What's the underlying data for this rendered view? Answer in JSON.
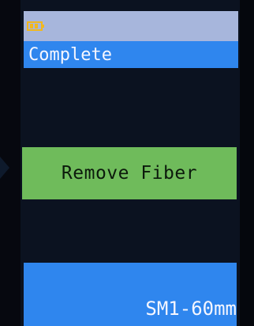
{
  "header": {
    "icon": "battery-icon"
  },
  "status": {
    "label": "Complete"
  },
  "message": {
    "label": "Remove Fiber"
  },
  "program": {
    "label": "SM1-60mm"
  },
  "colors": {
    "status_bar": "#2f86ee",
    "message_box": "#6fbb5b",
    "header_strip": "#a7b6dc",
    "background": "#0b1220"
  }
}
